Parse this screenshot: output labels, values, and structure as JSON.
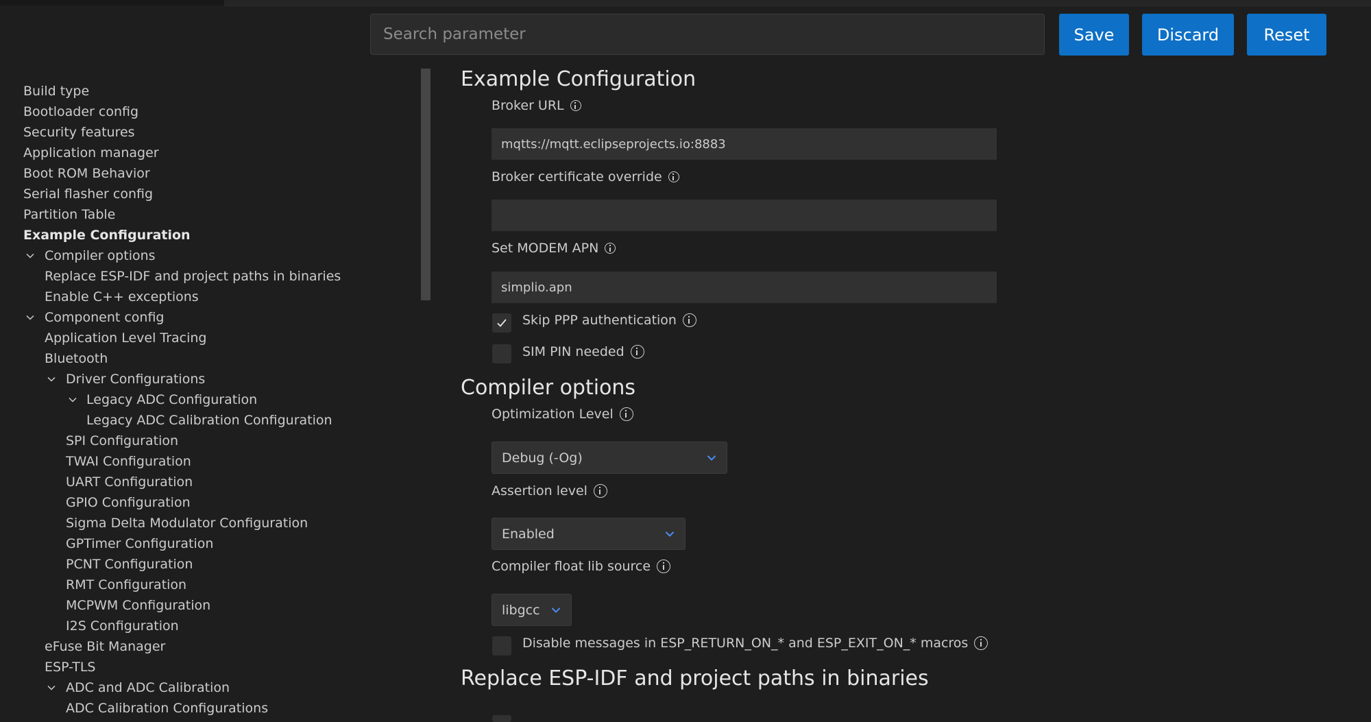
{
  "toolbar": {
    "search_placeholder": "Search parameter",
    "save_label": "Save",
    "discard_label": "Discard",
    "reset_label": "Reset"
  },
  "sidebar": {
    "items": [
      {
        "label": "Build type"
      },
      {
        "label": "Bootloader config"
      },
      {
        "label": "Security features"
      },
      {
        "label": "Application manager"
      },
      {
        "label": "Boot ROM Behavior"
      },
      {
        "label": "Serial flasher config"
      },
      {
        "label": "Partition Table"
      },
      {
        "label": "Example Configuration"
      },
      {
        "label": "Compiler options"
      },
      {
        "label": "Replace ESP-IDF and project paths in binaries"
      },
      {
        "label": "Enable C++ exceptions"
      },
      {
        "label": "Component config"
      },
      {
        "label": "Application Level Tracing"
      },
      {
        "label": "Bluetooth"
      },
      {
        "label": "Driver Configurations"
      },
      {
        "label": "Legacy ADC Configuration"
      },
      {
        "label": "Legacy ADC Calibration Configuration"
      },
      {
        "label": "SPI Configuration"
      },
      {
        "label": "TWAI Configuration"
      },
      {
        "label": "UART Configuration"
      },
      {
        "label": "GPIO Configuration"
      },
      {
        "label": "Sigma Delta Modulator Configuration"
      },
      {
        "label": "GPTimer Configuration"
      },
      {
        "label": "PCNT Configuration"
      },
      {
        "label": "RMT Configuration"
      },
      {
        "label": "MCPWM Configuration"
      },
      {
        "label": "I2S Configuration"
      },
      {
        "label": "eFuse Bit Manager"
      },
      {
        "label": "ESP-TLS"
      },
      {
        "label": "ADC and ADC Calibration"
      },
      {
        "label": "ADC Calibration Configurations"
      }
    ]
  },
  "example_config": {
    "title": "Example Configuration",
    "broker_url": {
      "label": "Broker URL",
      "value": "mqtts://mqtt.eclipseprojects.io:8883"
    },
    "broker_cert": {
      "label": "Broker certificate override",
      "value": ""
    },
    "modem_apn": {
      "label": "Set MODEM APN",
      "value": "simplio.apn"
    },
    "skip_ppp": {
      "label": "Skip PPP authentication",
      "checked": true
    },
    "sim_pin": {
      "label": "SIM PIN needed",
      "checked": false
    }
  },
  "compiler_options": {
    "title": "Compiler options",
    "optimization": {
      "label": "Optimization Level",
      "value": "Debug (-Og)"
    },
    "assertion": {
      "label": "Assertion level",
      "value": "Enabled"
    },
    "float_lib": {
      "label": "Compiler float lib source",
      "value": "libgcc"
    },
    "disable_messages": {
      "label": "Disable messages in ESP_RETURN_ON_* and ESP_EXIT_ON_* macros",
      "checked": false
    }
  },
  "replace_paths": {
    "title": "Replace ESP-IDF and project paths in binaries"
  },
  "colors": {
    "background": "#1e1e1e",
    "button": "#0e70c7",
    "chevron_accent": "#4d8cf5"
  }
}
